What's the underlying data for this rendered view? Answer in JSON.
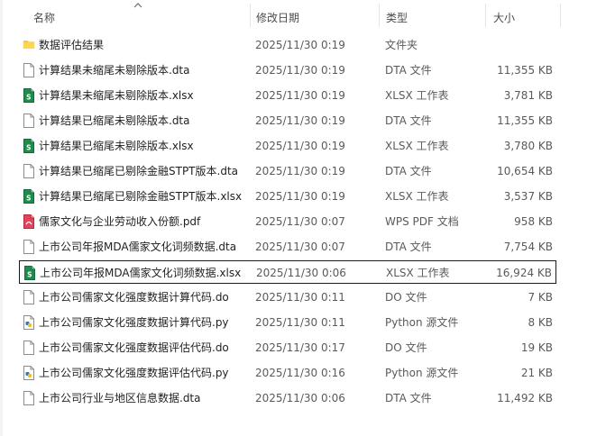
{
  "header": {
    "name": "名称",
    "date": "修改日期",
    "type": "类型",
    "size": "大小"
  },
  "files": [
    {
      "name": "数据评估结果",
      "date": "2025/11/30 0:19",
      "type": "文件夹",
      "size": "",
      "icon": "folder-icon"
    },
    {
      "name": "计算结果未缩尾未剔除版本.dta",
      "date": "2025/11/30 0:19",
      "type": "DTA 文件",
      "size": "11,355 KB",
      "icon": "file-icon"
    },
    {
      "name": "计算结果未缩尾未剔除版本.xlsx",
      "date": "2025/11/30 0:19",
      "type": "XLSX 工作表",
      "size": "3,781 KB",
      "icon": "excel-icon"
    },
    {
      "name": "计算结果已缩尾未剔除版本.dta",
      "date": "2025/11/30 0:19",
      "type": "DTA 文件",
      "size": "11,355 KB",
      "icon": "file-icon"
    },
    {
      "name": "计算结果已缩尾未剔除版本.xlsx",
      "date": "2025/11/30 0:19",
      "type": "XLSX 工作表",
      "size": "3,780 KB",
      "icon": "excel-icon"
    },
    {
      "name": "计算结果已缩尾已剔除金融STPT版本.dta",
      "date": "2025/11/30 0:19",
      "type": "DTA 文件",
      "size": "10,654 KB",
      "icon": "file-icon"
    },
    {
      "name": "计算结果已缩尾已剔除金融STPT版本.xlsx",
      "date": "2025/11/30 0:19",
      "type": "XLSX 工作表",
      "size": "3,537 KB",
      "icon": "excel-icon"
    },
    {
      "name": "儒家文化与企业劳动收入份额.pdf",
      "date": "2025/11/30 0:07",
      "type": "WPS PDF 文档",
      "size": "958 KB",
      "icon": "pdf-icon"
    },
    {
      "name": "上市公司年报MDA儒家文化词频数据.dta",
      "date": "2025/11/30 0:07",
      "type": "DTA 文件",
      "size": "7,754 KB",
      "icon": "file-icon"
    },
    {
      "name": "上市公司年报MDA儒家文化词频数据.xlsx",
      "date": "2025/11/30 0:06",
      "type": "XLSX 工作表",
      "size": "16,924 KB",
      "icon": "excel-icon",
      "selected": true
    },
    {
      "name": "上市公司儒家文化强度数据计算代码.do",
      "date": "2025/11/30 0:11",
      "type": "DO 文件",
      "size": "7 KB",
      "icon": "file-icon"
    },
    {
      "name": "上市公司儒家文化强度数据计算代码.py",
      "date": "2025/11/30 0:11",
      "type": "Python 源文件",
      "size": "8 KB",
      "icon": "python-icon"
    },
    {
      "name": "上市公司儒家文化强度数据评估代码.do",
      "date": "2025/11/30 0:17",
      "type": "DO 文件",
      "size": "19 KB",
      "icon": "file-icon"
    },
    {
      "name": "上市公司儒家文化强度数据评估代码.py",
      "date": "2025/11/30 0:16",
      "type": "Python 源文件",
      "size": "21 KB",
      "icon": "python-icon"
    },
    {
      "name": "上市公司行业与地区信息数据.dta",
      "date": "2025/11/30 0:06",
      "type": "DTA 文件",
      "size": "11,492 KB",
      "icon": "file-icon"
    }
  ]
}
